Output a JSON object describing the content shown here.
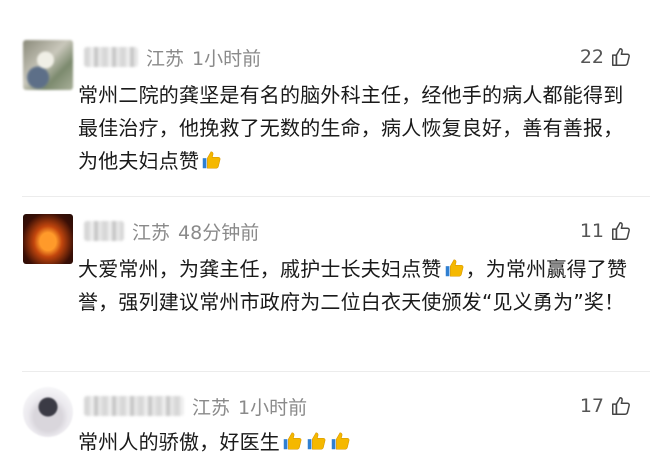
{
  "comments": [
    {
      "location": "江苏",
      "time": "1小时前",
      "likes": "22",
      "text": "常州二院的龚坚是有名的脑外科主任，经他手的病人都能得到最佳治疗，他挽救了无数的生命，病人恢复良好，善有善报，为他夫妇点赞",
      "emojis": [
        "thumbs-up-emoji"
      ]
    },
    {
      "location": "江苏",
      "time": "48分钟前",
      "likes": "11",
      "text_part1": "大爱常州，为龚主任，戚护士长夫妇点赞",
      "text_part2": "，为常州赢得了赞誉，强列建议常州市政府为二位白衣天使颁发“见义勇为”奖！",
      "emojis": [
        "thumbs-up-emoji"
      ]
    },
    {
      "location": "江苏",
      "time": "1小时前",
      "likes": "17",
      "text": "常州人的骄傲，好医生",
      "emojis": [
        "thumbs-up-emoji",
        "thumbs-up-emoji",
        "thumbs-up-emoji"
      ]
    }
  ],
  "colors": {
    "meta": "#8a8a8a",
    "text": "#1a1a1a",
    "thumb": "#f5b800"
  }
}
